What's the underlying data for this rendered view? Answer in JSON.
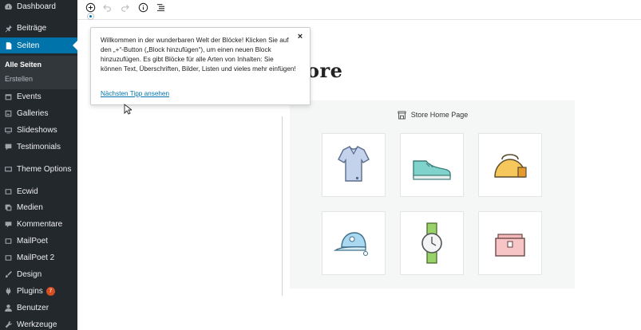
{
  "sidebar": {
    "items": [
      {
        "key": "dashboard",
        "label": "Dashboard",
        "icon": "dashboard-icon"
      },
      {
        "key": "posts",
        "label": "Beiträge",
        "icon": "pin-icon"
      },
      {
        "key": "pages",
        "label": "Seiten",
        "icon": "pages-icon",
        "active": true
      },
      {
        "key": "events",
        "label": "Events",
        "icon": "events-icon"
      },
      {
        "key": "galleries",
        "label": "Galleries",
        "icon": "gallery-icon"
      },
      {
        "key": "slideshows",
        "label": "Slideshows",
        "icon": "slideshow-icon"
      },
      {
        "key": "testimonials",
        "label": "Testimonials",
        "icon": "testimonial-icon"
      },
      {
        "key": "theme-options",
        "label": "Theme Options",
        "icon": "theme-options-icon"
      },
      {
        "key": "ecwid",
        "label": "Ecwid",
        "icon": "ecwid-icon"
      },
      {
        "key": "media",
        "label": "Medien",
        "icon": "media-icon"
      },
      {
        "key": "comments",
        "label": "Kommentare",
        "icon": "comment-icon"
      },
      {
        "key": "mailpoet",
        "label": "MailPoet",
        "icon": "mailpoet-icon"
      },
      {
        "key": "mailpoet2",
        "label": "MailPoet 2",
        "icon": "mailpoet-icon"
      },
      {
        "key": "design",
        "label": "Design",
        "icon": "brush-icon"
      },
      {
        "key": "plugins",
        "label": "Plugins",
        "icon": "plugin-icon",
        "badge": "7"
      },
      {
        "key": "users",
        "label": "Benutzer",
        "icon": "user-icon"
      },
      {
        "key": "tools",
        "label": "Werkzeuge",
        "icon": "wrench-icon"
      }
    ],
    "submenu": [
      {
        "label": "Alle Seiten",
        "current": true
      },
      {
        "label": "Erstellen"
      }
    ]
  },
  "toolbar": {
    "add_icon": "plus-circle-icon",
    "undo_icon": "undo-icon",
    "redo_icon": "redo-icon",
    "info_icon": "info-icon",
    "outline_icon": "list-outline-icon"
  },
  "tip": {
    "text": "Willkommen in der wunderbaren Welt der Blöcke! Klicken Sie auf den „+“-Button („Block hinzufügen“), um einen neuen Block hinzuzufügen. Es gibt Blöcke für alle Arten von Inhalten: Sie können Text, Überschriften, Bilder, Listen und vieles mehr einfügen!",
    "link": "Nächsten Tipp ansehen",
    "close": "×"
  },
  "editor": {
    "title_fragment": "ore"
  },
  "store": {
    "heading": "Store Home Page",
    "products": [
      {
        "icon": "tshirt-icon"
      },
      {
        "icon": "sneaker-icon"
      },
      {
        "icon": "bag-icon"
      },
      {
        "icon": "cap-icon"
      },
      {
        "icon": "watch-icon"
      },
      {
        "icon": "wallet-icon"
      }
    ]
  },
  "colors": {
    "sidebar_bg": "#23282d",
    "accent": "#0073aa",
    "badge": "#d54e21"
  }
}
